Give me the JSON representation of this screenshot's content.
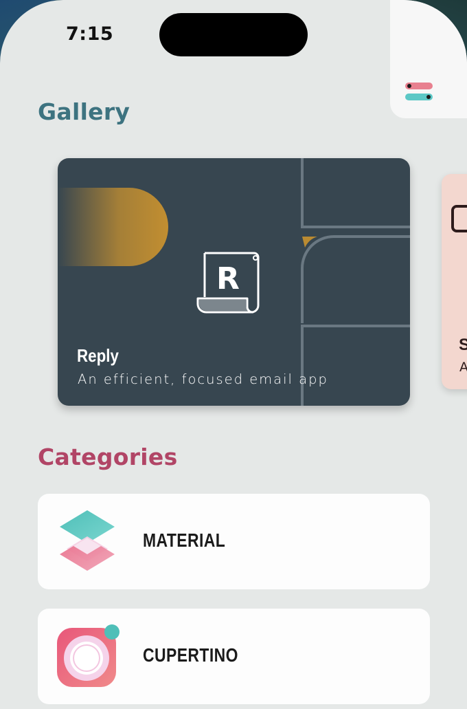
{
  "status_bar": {
    "time": "7:15"
  },
  "header": {
    "menu_icon": "menu-sliders-icon"
  },
  "gallery": {
    "title": "Gallery",
    "cards": [
      {
        "name": "Reply",
        "subtitle": "An efficient, focused email app",
        "icon": "reply-logo-icon",
        "color": "#374650"
      },
      {
        "name": "S",
        "subtitle": "A",
        "icon": "shrine-logo-icon",
        "color": "#f3d7cf"
      }
    ]
  },
  "categories": {
    "title": "Categories",
    "items": [
      {
        "label": "MATERIAL",
        "icon": "material-layers-icon"
      },
      {
        "label": "CUPERTINO",
        "icon": "cupertino-ring-icon"
      }
    ]
  },
  "colors": {
    "gallery_title": "#3d7380",
    "categories_title": "#b14566",
    "background": "#e5e8e7",
    "card_dark": "#374650",
    "accent_gold": "#c9922f"
  }
}
